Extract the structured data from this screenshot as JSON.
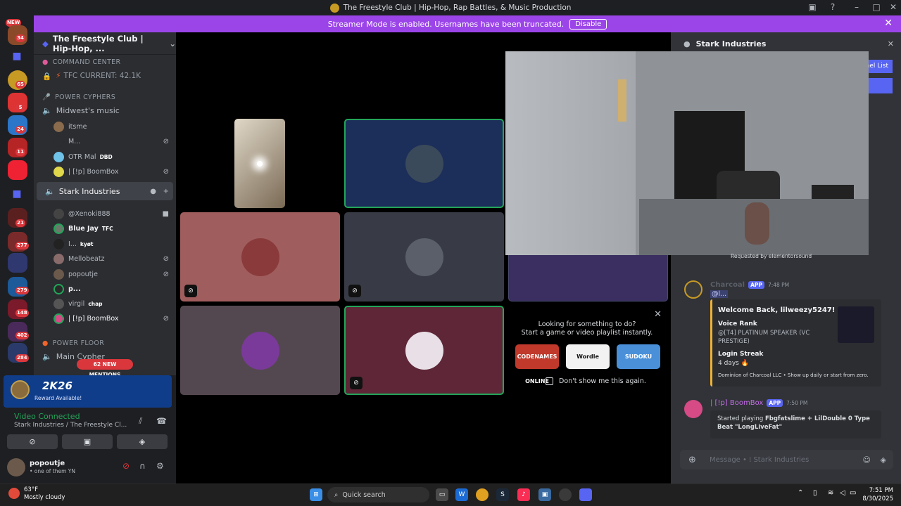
{
  "window": {
    "title": "The Freestyle Club | Hip-Hop, Rap Battles, & Music Production"
  },
  "banner": {
    "text": "Streamer Mode is enabled. Usernames have been truncated.",
    "button": "Disable"
  },
  "rail": {
    "new_label": "NEW",
    "badges": [
      "34",
      "65",
      "5",
      "24",
      "11",
      "21",
      "277",
      "279",
      "148",
      "402",
      "284"
    ]
  },
  "server": {
    "name": "The Freestyle Club | Hip-Hop, ..."
  },
  "channels": {
    "command_center": "COMMAND CENTER",
    "tfc_current": "TFC CURRENT: 42.1K",
    "power_cyphers": "POWER CYPHERS",
    "midwest": "Midwest's music",
    "m1": "itsme",
    "m2": "M...",
    "m3": "OTR Mal",
    "m3_tag": "DBD",
    "m4": "| [!p] BoomBox",
    "stark": "Stark Industries",
    "s1": "@Xenoki888",
    "s2": "Blue Jay",
    "s2_tag": "TFC",
    "s3": "I...",
    "s3_tag": "kyøt",
    "s4": "Mellobeatz",
    "s5": "popoutje",
    "s6": "p...",
    "s7": "virgil",
    "s7_tag": "chap",
    "s8": "| [!p] BoomBox",
    "power_floor": "POWER FLOOR",
    "main_cypher": "Main Cypher",
    "mentions": "62 NEW MENTIONS"
  },
  "promo": {
    "title": "2K26",
    "subtitle": "Reward Available!"
  },
  "voice": {
    "status": "Video Connected",
    "location": "Stark Industries / The Freestyle Cl...",
    "user_name": "popoutje",
    "user_status": "• one of them YN"
  },
  "activity": {
    "line1": "Looking for something to do?",
    "line2": "Start a game or video playlist instantly.",
    "games": [
      "CODENAMES ONLINE",
      "Wordle",
      "SUDOKU"
    ],
    "dont_show": "Don't show me this again."
  },
  "chat": {
    "header": "Stark Industries",
    "channel_list": "nel List",
    "requested_by": "Requested by elementorsound",
    "msg1_author": "Charcoal",
    "msg1_app": "APP",
    "msg1_time": "7:48 PM",
    "msg1_mention": "@l...",
    "embed_title": "Welcome Back, lilweezy5247!",
    "embed_f1_name": "Voice Rank",
    "embed_f1_value": "@[T4] PLATINUM SPEAKER (VC PRESTIGE)",
    "embed_f2_name": "Login Streak",
    "embed_f2_value": "4 days 🔥",
    "embed_footer": "Dominion of Charcoal LLC • Show up daily or start from zero.",
    "msg2_author": "| [!p] BoomBox",
    "msg2_app": "APP",
    "msg2_time": "7:50 PM",
    "msg2_prefix": "Started playing ",
    "msg2_bold": "Fbgfatslime + LilDouble 0 Type Beat \"LongLiveFat\"",
    "composer_placeholder": "Message • ⁞ Stark Industries"
  },
  "taskbar": {
    "temp": "63°F",
    "weather": "Mostly cloudy",
    "search": "Quick search",
    "time": "7:51 PM",
    "date": "8/30/2025"
  }
}
